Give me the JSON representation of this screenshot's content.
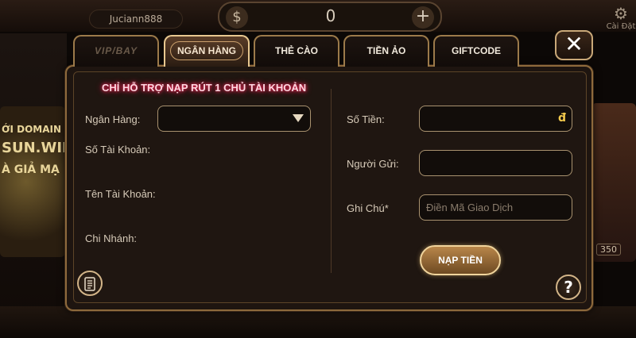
{
  "background": {
    "username": "Juciann888",
    "balance": "0",
    "currency_icon": "$",
    "settings_label": "Cài Đặt",
    "left_promo_lines": [
      "ỚI DOMAIN KH",
      "SUN.WIN",
      "À GIẢ MẠ"
    ],
    "right_badge": "350"
  },
  "tabs": [
    {
      "label": "VIP/BAY",
      "active": false
    },
    {
      "label": "NGÂN HÀNG",
      "active": true
    },
    {
      "label": "THẺ CÀO",
      "active": false
    },
    {
      "label": "TIỀN ẢO",
      "active": false
    },
    {
      "label": "GIFTCODE",
      "active": false
    }
  ],
  "notice": "CHỈ HỖ TRỢ NẠP RÚT 1 CHỦ TÀI KHOẢN",
  "left_form": {
    "bank_label": "Ngân Hàng:",
    "account_number_label": "Số Tài Khoản:",
    "account_name_label": "Tên Tài Khoản:",
    "branch_label": "Chi Nhánh:"
  },
  "right_form": {
    "amount_label": "Số Tiền:",
    "amount_currency": "đ",
    "sender_label": "Người Gửi:",
    "note_label": "Ghi Chú*",
    "note_placeholder": "Điền Mã Giao Dịch",
    "deposit_button": "NẠP TIỀN"
  },
  "icons": {
    "close": "close-icon",
    "help": "question-icon",
    "history": "document-icon",
    "dropdown": "triangle-down-icon"
  },
  "colors": {
    "accent_gold": "#e8c890",
    "notice_glow": "#ff2a5a",
    "panel_bg": "#1e1510"
  }
}
